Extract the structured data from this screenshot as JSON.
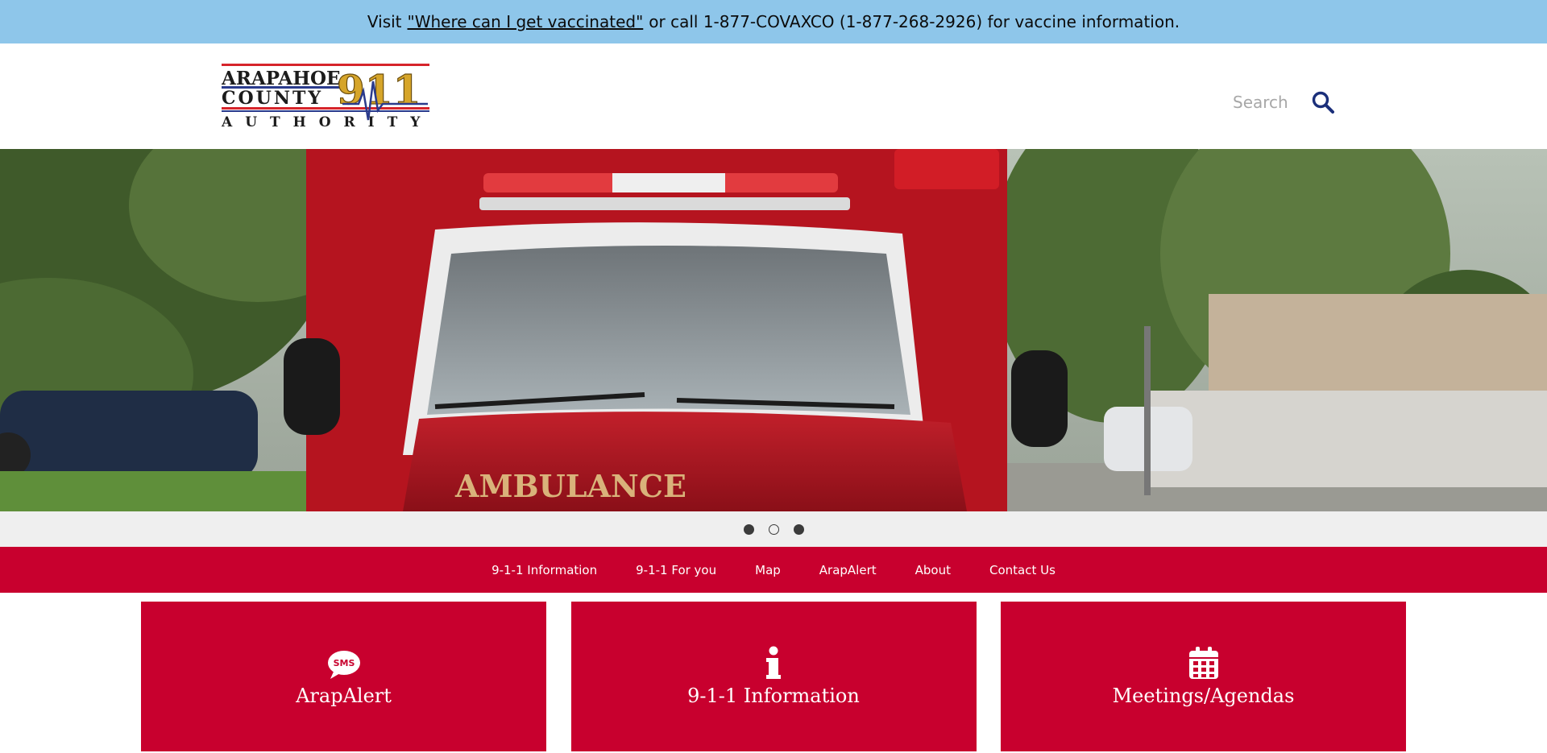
{
  "alert": {
    "prefix": "Visit",
    "link_text": "\"Where can I get vaccinated\"",
    "suffix": "or call 1-877-COVAXCO (1-877-268-2926) for vaccine information."
  },
  "logo": {
    "line1": "ARAPAHOE",
    "line2": "COUNTY",
    "line3": "AUTHORITY",
    "number": "911"
  },
  "search": {
    "placeholder": "Search"
  },
  "hero": {
    "vehicle_text": "AMBULANCE"
  },
  "slider": {
    "count": 3,
    "active": [
      true,
      false,
      true
    ]
  },
  "nav": {
    "items": [
      "9-1-1 Information",
      "9-1-1 For you",
      "Map",
      "ArapAlert",
      "About",
      "Contact Us"
    ]
  },
  "cards": [
    {
      "label": "ArapAlert",
      "icon": "sms-icon"
    },
    {
      "label": "9-1-1 Information",
      "icon": "info-icon"
    },
    {
      "label": "Meetings/Agendas",
      "icon": "calendar-icon"
    }
  ],
  "colors": {
    "alert_bg": "#8ec6ea",
    "brand_red": "#c8002e",
    "search_icon": "#1b2f7a",
    "logo_navy": "#1a1f4d",
    "logo_gold": "#d6a52a"
  }
}
